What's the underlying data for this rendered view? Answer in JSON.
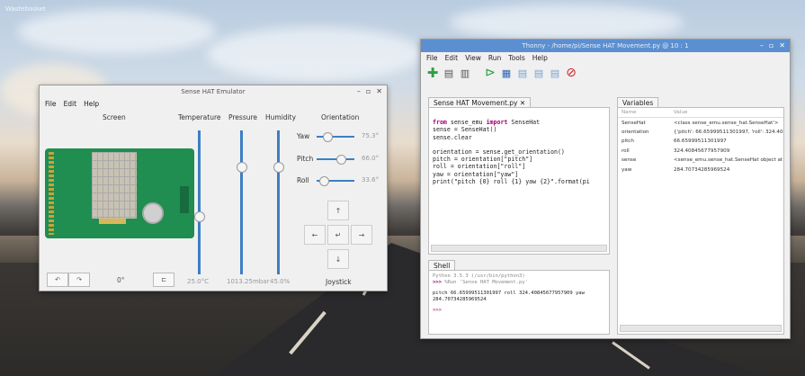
{
  "desktop": {
    "label": "Wastebasket"
  },
  "sense_hat": {
    "title": "Sense HAT Emulator",
    "menu": [
      "File",
      "Edit",
      "Help"
    ],
    "screen_label": "Screen",
    "columns": {
      "temperature": "Temperature",
      "pressure": "Pressure",
      "humidity": "Humidity",
      "orientation": "Orientation"
    },
    "values": {
      "temperature": "25.0°C",
      "pressure": "1013.25mbar",
      "humidity": "45.0%"
    },
    "levels": {
      "temperature": 0.4,
      "pressure": 0.77,
      "humidity": 0.77
    },
    "orientation": {
      "yaw_label": "Yaw",
      "yaw_value": "75.3°",
      "yaw_level": 0.21,
      "pitch_label": "Pitch",
      "pitch_value": "66.0°",
      "pitch_level": 0.68,
      "roll_label": "Roll",
      "roll_value": "33.6°",
      "roll_level": 0.09
    },
    "rotation": "0°",
    "joystick_label": "Joystick",
    "joystick": {
      "up": "↑",
      "down": "↓",
      "left": "←",
      "right": "→",
      "center": "↵"
    }
  },
  "thonny": {
    "title": "Thonny - /home/pi/Sense HAT Movement.py @ 10 : 1",
    "menu": [
      "File",
      "Edit",
      "View",
      "Run",
      "Tools",
      "Help"
    ],
    "editor_tab": "Sense HAT Movement.py ✕",
    "code": [
      {
        "kw": "from",
        "rest1": " sense_emu ",
        "kw2": "import",
        "rest2": " SenseHat"
      },
      {
        "plain": "sense = SenseHat()"
      },
      {
        "plain": "sense.clear"
      },
      {
        "plain": ""
      },
      {
        "plain": "orientation = sense.get_orientation()"
      },
      {
        "plain": "pitch = orientation[\"pitch\"]"
      },
      {
        "plain": "roll = orientation[\"roll\"]"
      },
      {
        "plain": "yaw = orientation[\"yaw\"]"
      },
      {
        "plain": "print(\"pitch {0} roll {1} yaw {2}\".format(pi"
      }
    ],
    "variables_tab": "Variables",
    "variables_header": {
      "name": "Name",
      "value": "Value"
    },
    "variables": [
      {
        "name": "SenseHat",
        "value": "<class sense_emu.sense_hat.SenseHat'>"
      },
      {
        "name": "orientation",
        "value": "{'pitch': 66.65999511301997, 'roll': 324.4084..."
      },
      {
        "name": "pitch",
        "value": "66.65999511301997"
      },
      {
        "name": "roll",
        "value": "324.40845677957909"
      },
      {
        "name": "sense",
        "value": "<sense_emu.sense_hat.SenseHat object at 0x..."
      },
      {
        "name": "yaw",
        "value": "284.70734285969524"
      }
    ],
    "shell_tab": "Shell",
    "shell": {
      "version": "Python 3.5.3 (/usr/bin/python3)",
      "prompt1": ">>> ",
      "run_cmd": "%Run 'Sense HAT Movement.py'",
      "output1": "pitch 66.65999511301997 roll 324.40845677957909 yaw",
      "output2": "284.70734285969524",
      "prompt2": ">>>"
    }
  },
  "colors": {
    "accent": "#5b8fd0",
    "run_green": "#2ea043",
    "stop_red": "#d01e25",
    "board_green": "#1f8e50"
  }
}
